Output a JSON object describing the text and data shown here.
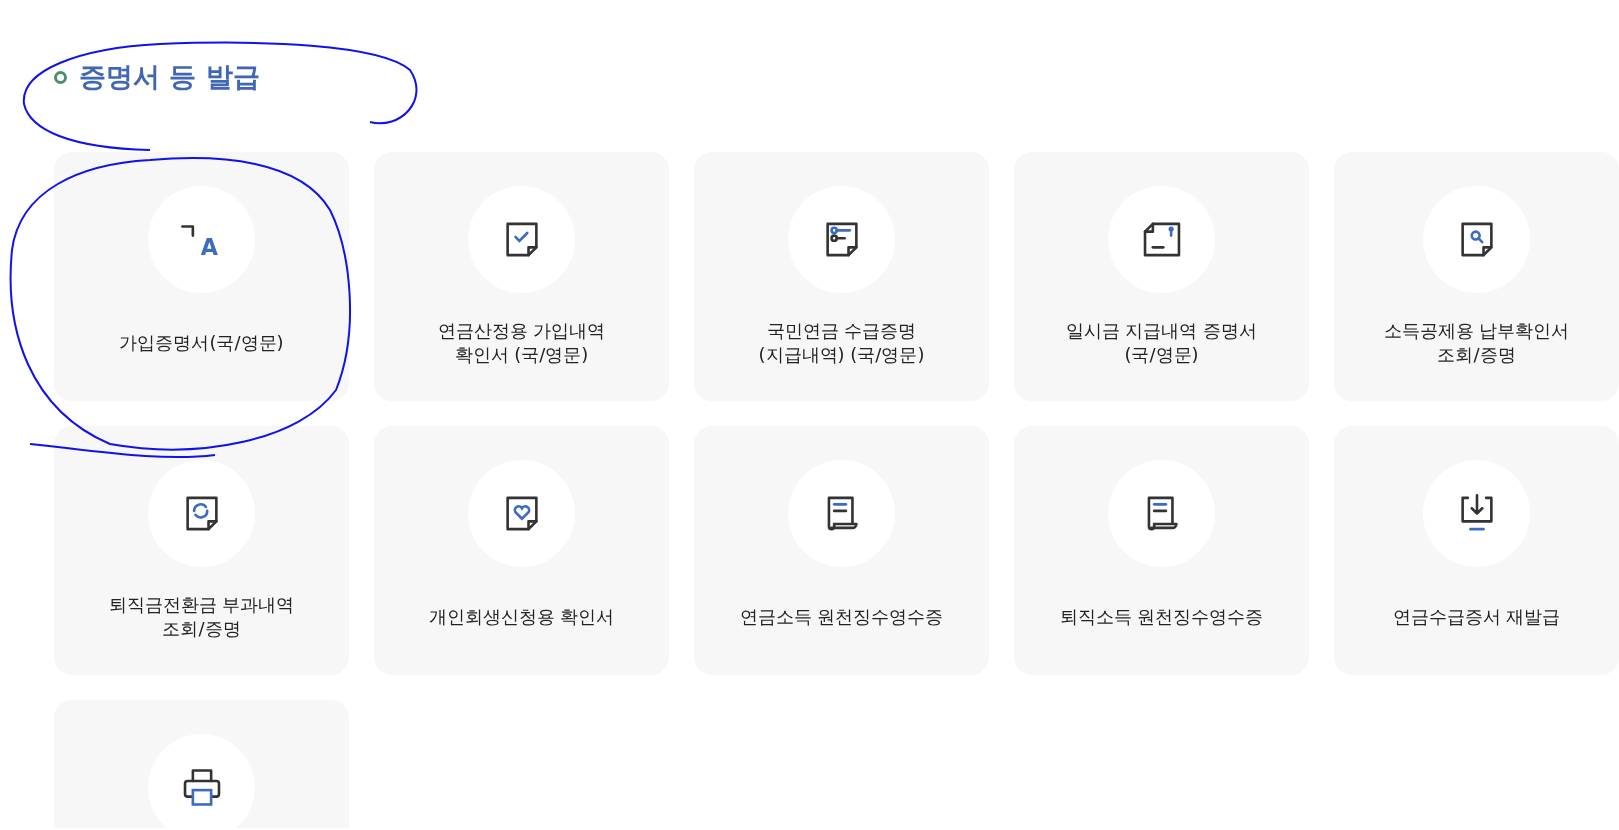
{
  "section": {
    "title": "증명서 등 발급"
  },
  "cards": [
    {
      "label": "가입증명서(국/영문)",
      "icon_text": "A"
    },
    {
      "label": "연금산정용 가입내역\n확인서 (국/영문)"
    },
    {
      "label": "국민연금 수급증명\n(지급내역) (국/영문)"
    },
    {
      "label": "일시금 지급내역 증명서\n(국/영문)"
    },
    {
      "label": "소득공제용 납부확인서\n조회/증명"
    },
    {
      "label": "퇴직금전환금 부과내역\n조회/증명"
    },
    {
      "label": "개인회생신청용 확인서"
    },
    {
      "label": "연금소득 원천징수영수증"
    },
    {
      "label": "퇴직소득 원천징수영수증"
    },
    {
      "label": "연금수급증서 재발급"
    },
    {
      "cut_off": true
    }
  ]
}
